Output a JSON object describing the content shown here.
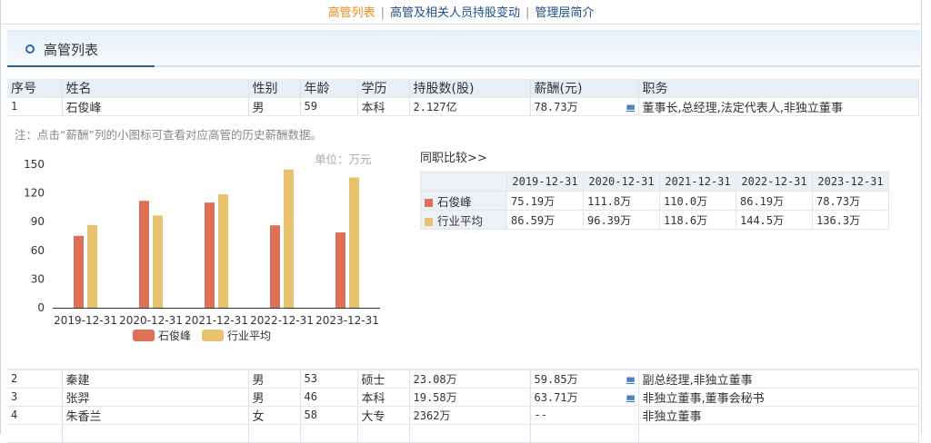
{
  "topnav": {
    "items": [
      "高管列表",
      "高管及相关人员持股变动",
      "管理层简介"
    ],
    "sep": "|"
  },
  "section": {
    "title": "高管列表"
  },
  "table": {
    "headers": [
      "序号",
      "姓名",
      "性别",
      "年龄",
      "学历",
      "持股数(股)",
      "薪酬(元)",
      "职务"
    ],
    "rows": [
      [
        "1",
        "石俊峰",
        "男",
        "59",
        "本科",
        "2.127亿",
        "78.73万",
        "董事长,总经理,法定代表人,非独立董事"
      ],
      [
        "2",
        "秦建",
        "男",
        "53",
        "硕士",
        "23.08万",
        "59.85万",
        "副总经理,非独立董事"
      ],
      [
        "3",
        "张羿",
        "男",
        "46",
        "本科",
        "19.58万",
        "63.71万",
        "非独立董事,董事会秘书"
      ],
      [
        "4",
        "朱香兰",
        "女",
        "58",
        "大专",
        "2362万",
        "--",
        "非独立董事"
      ]
    ],
    "chart_icon": "bar-chart-icon"
  },
  "detail": {
    "note": "注：点击“薪酬”列的小图标可查看对应高管的历史薪酬数据。",
    "unit": "单位：万元",
    "compare_title": "同职比较>>",
    "compare": {
      "dates": [
        "2019-12-31",
        "2020-12-31",
        "2021-12-31",
        "2022-12-31",
        "2023-12-31"
      ],
      "rows": [
        {
          "name": "石俊峰",
          "values": [
            "75.19万",
            "111.8万",
            "110.0万",
            "86.19万",
            "78.73万"
          ]
        },
        {
          "name": "行业平均",
          "values": [
            "86.59万",
            "96.39万",
            "118.6万",
            "144.5万",
            "136.3万"
          ]
        }
      ]
    }
  },
  "colors": {
    "series1": "#de7155",
    "series2": "#e8c26e",
    "accent": "#f08a1c",
    "link": "#1d4d8c"
  },
  "chart_data": {
    "type": "bar",
    "categories": [
      "2019-12-31",
      "2020-12-31",
      "2021-12-31",
      "2022-12-31",
      "2023-12-31"
    ],
    "series": [
      {
        "name": "石俊峰",
        "values": [
          75.19,
          111.8,
          110.0,
          86.19,
          78.73
        ]
      },
      {
        "name": "行业平均",
        "values": [
          86.59,
          96.39,
          118.6,
          144.5,
          136.3
        ]
      }
    ],
    "yticks": [
      "0",
      "30",
      "60",
      "90",
      "120",
      "150"
    ],
    "ylim": [
      0,
      150
    ],
    "ylabel": "单位：万元",
    "legend": "bottom"
  }
}
